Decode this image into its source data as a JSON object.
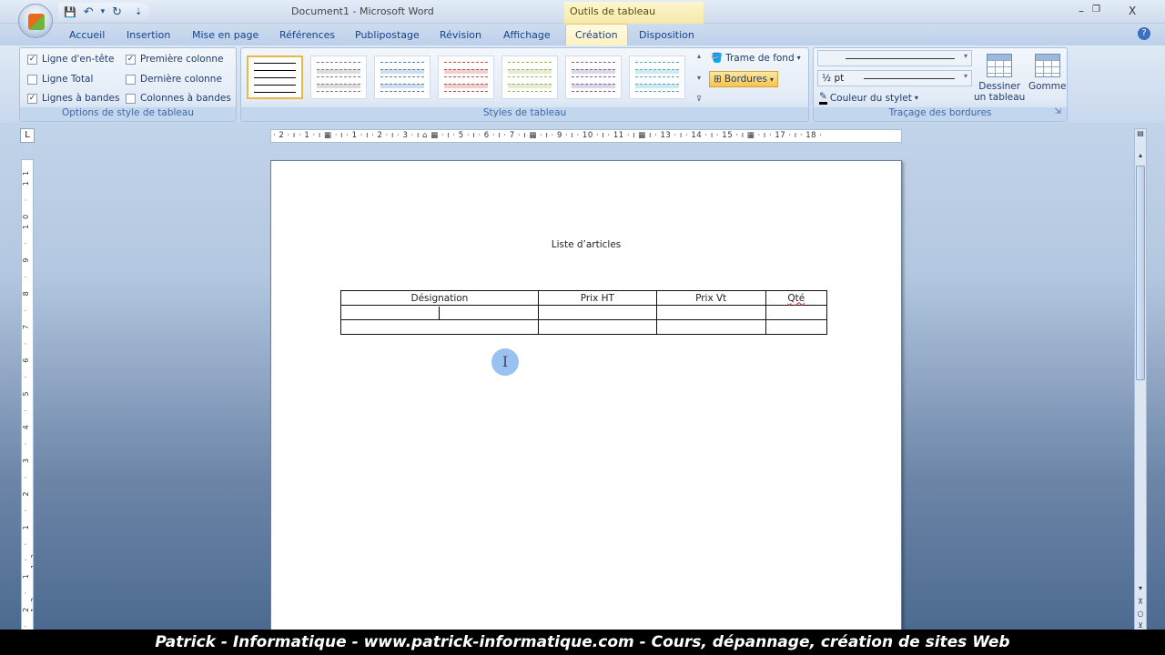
{
  "window": {
    "title": "Document1 - Microsoft Word",
    "context_tab": "Outils de tableau",
    "minimize": "–",
    "restore": "❐",
    "close": "X"
  },
  "qat": {
    "save": "💾",
    "undo": "↶",
    "undo_dd": "▾",
    "redo": "↻",
    "customize": "⇣"
  },
  "tabs": [
    "Accueil",
    "Insertion",
    "Mise en page",
    "Références",
    "Publipostage",
    "Révision",
    "Affichage",
    "Création",
    "Disposition"
  ],
  "active_tab": "Création",
  "help": "?",
  "ribbon": {
    "style_options": {
      "label": "Options de style de tableau",
      "items": [
        {
          "label": "Ligne d'en-tête",
          "checked": true
        },
        {
          "label": "Ligne Total",
          "checked": false
        },
        {
          "label": "Lignes à bandes",
          "checked": true
        },
        {
          "label": "Première colonne",
          "checked": true
        },
        {
          "label": "Dernière colonne",
          "checked": false
        },
        {
          "label": "Colonnes à bandes",
          "checked": false
        }
      ]
    },
    "table_styles": {
      "label": "Styles de tableau",
      "swatch_colors": [
        "#000000",
        "#7f7f7f",
        "#4f81bd",
        "#c0504d",
        "#9bbb59",
        "#8064a2",
        "#4bacc6"
      ],
      "up": "▴",
      "down": "▾",
      "more": "⊽"
    },
    "shading": "Trame de fond",
    "borders": "Bordures",
    "dd": "▾",
    "draw_borders": {
      "label": "Traçage des bordures",
      "line_weight": "½ pt",
      "pen_color": "Couleur du stylet",
      "draw_table": [
        "Dessiner",
        "un tableau"
      ],
      "eraser": "Gomme",
      "launcher": "⇲"
    }
  },
  "ruler": {
    "tab_selector": "L",
    "horizontal": "· 2 · ı · 1 · ı ▦ · ı · 1 · ı · 2 · ı · 3 · ı ⌂ ▦ · ı · 5 · ı · 6 · ı · 7 · ı ▦ · ı · 9 · ı · 10 · ı · 11 · ı ▦ ı · 13 · ı · 14 · ı · 15 · ı ▦ · ı · 17 · ı · 18 ·",
    "vertical": "· 2 · 1 · · 1 · 2 · 3 · 4 · 5 · 6 · 7 · 8 · 9 · 10 · 11 · 12 · 13"
  },
  "document": {
    "title": "Liste d’articles",
    "table": {
      "headers": [
        "Désignation",
        "Prix HT",
        "Prix Vt",
        "Qté"
      ],
      "rows": [
        [
          "",
          "",
          "",
          ""
        ],
        [
          "",
          "",
          "",
          ""
        ]
      ]
    },
    "cursor": "I"
  },
  "scrollbar": {
    "up": "▴",
    "down": "▾",
    "prev": "⊼",
    "select": "○",
    "next": "⊻"
  },
  "banner": "Patrick - Informatique - www.patrick-informatique.com - Cours, dépannage, création de sites Web"
}
